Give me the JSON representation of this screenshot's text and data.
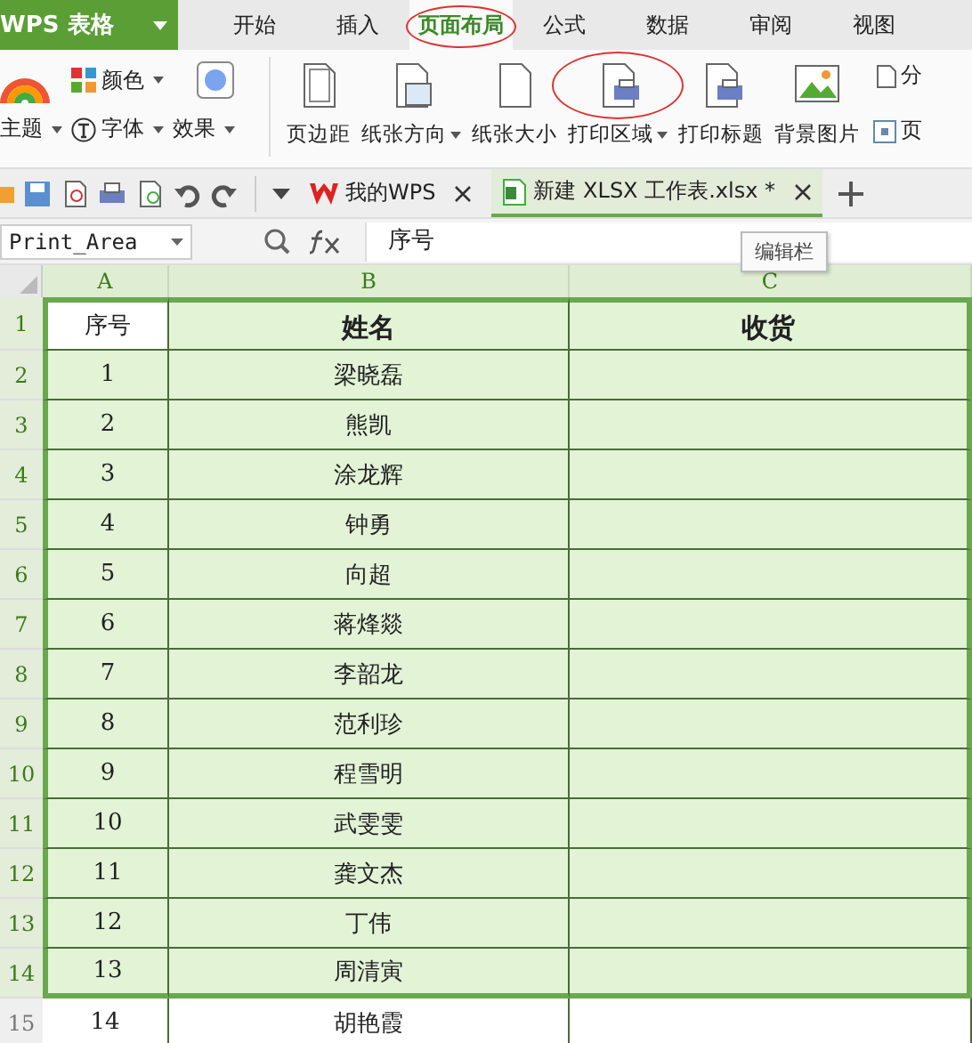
{
  "app": {
    "logo": "WPS 表格"
  },
  "menu_tabs": [
    {
      "label": "开始",
      "selected": false,
      "circled": false
    },
    {
      "label": "插入",
      "selected": false,
      "circled": false
    },
    {
      "label": "页面布局",
      "selected": true,
      "circled": true
    },
    {
      "label": "公式",
      "selected": false,
      "circled": false
    },
    {
      "label": "数据",
      "selected": false,
      "circled": false
    },
    {
      "label": "审阅",
      "selected": false,
      "circled": false
    },
    {
      "label": "视图",
      "selected": false,
      "circled": false
    }
  ],
  "theme_group": {
    "top": [
      {
        "label": "颜色",
        "dropdown": true
      }
    ],
    "bottom": [
      {
        "label": "主题",
        "dropdown": true
      },
      {
        "label": "字体",
        "dropdown": true
      },
      {
        "label": "效果",
        "dropdown": true
      }
    ]
  },
  "ribbon_buttons": [
    {
      "label": "页边距",
      "dropdown": false,
      "circled": false
    },
    {
      "label": "纸张方向",
      "dropdown": true,
      "circled": false
    },
    {
      "label": "纸张大小",
      "dropdown": false,
      "circled": false
    },
    {
      "label": "打印区域",
      "dropdown": true,
      "circled": true
    },
    {
      "label": "打印标题",
      "dropdown": false,
      "circled": false
    },
    {
      "label": "背景图片",
      "dropdown": false,
      "circled": false
    }
  ],
  "ribbon_cut": {
    "top": "分",
    "bottom": "页"
  },
  "doc_tabs": [
    {
      "label": "我的WPS",
      "selected": false
    },
    {
      "label": "新建 XLSX 工作表.xlsx *",
      "selected": true
    }
  ],
  "name_box": "Print_Area",
  "formula": "序号",
  "columns": [
    "A",
    "B",
    "C"
  ],
  "tooltip": "编辑栏",
  "rows": [
    {
      "number": "1",
      "selected": true,
      "cells": [
        "序号",
        "姓名",
        "收货"
      ]
    },
    {
      "number": "2",
      "selected": true,
      "cells": [
        "1",
        "梁晓磊",
        ""
      ]
    },
    {
      "number": "3",
      "selected": true,
      "cells": [
        "2",
        "熊凯",
        ""
      ]
    },
    {
      "number": "4",
      "selected": true,
      "cells": [
        "3",
        "涂龙辉",
        ""
      ]
    },
    {
      "number": "5",
      "selected": true,
      "cells": [
        "4",
        "钟勇",
        ""
      ]
    },
    {
      "number": "6",
      "selected": true,
      "cells": [
        "5",
        "向超",
        ""
      ]
    },
    {
      "number": "7",
      "selected": true,
      "cells": [
        "6",
        "蒋烽燚",
        ""
      ]
    },
    {
      "number": "8",
      "selected": true,
      "cells": [
        "7",
        "李韶龙",
        ""
      ]
    },
    {
      "number": "9",
      "selected": true,
      "cells": [
        "8",
        "范利珍",
        ""
      ]
    },
    {
      "number": "10",
      "selected": true,
      "cells": [
        "9",
        "程雪明",
        ""
      ]
    },
    {
      "number": "11",
      "selected": true,
      "cells": [
        "10",
        "武雯雯",
        ""
      ]
    },
    {
      "number": "12",
      "selected": true,
      "cells": [
        "11",
        "龚文杰",
        ""
      ]
    },
    {
      "number": "13",
      "selected": true,
      "cells": [
        "12",
        "丁伟",
        ""
      ]
    },
    {
      "number": "14",
      "selected": true,
      "cells": [
        "13",
        "周清寅",
        ""
      ]
    },
    {
      "number": "15",
      "selected": false,
      "cells": [
        "14",
        "胡艳霞",
        ""
      ]
    }
  ]
}
